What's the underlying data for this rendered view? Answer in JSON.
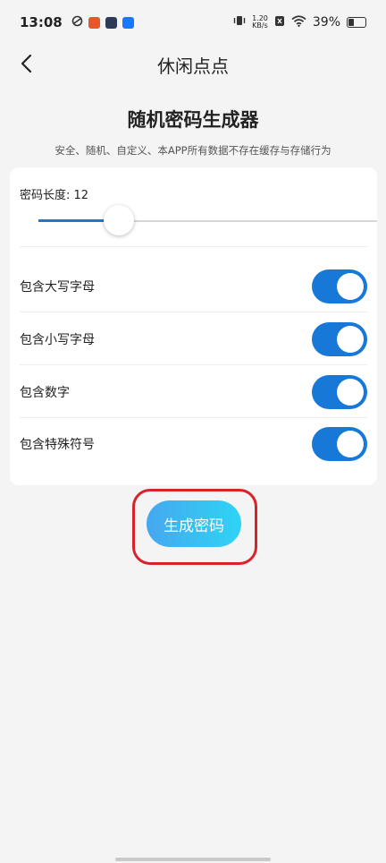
{
  "status_bar": {
    "time": "13:08",
    "net_speed_value": "1.20",
    "net_speed_unit": "KB/s",
    "battery": "39%"
  },
  "header": {
    "title": "休闲点点"
  },
  "page": {
    "title": "随机密码生成器",
    "subtitle": "安全、随机、自定义、本APP所有数据不存在缓存与存储行为"
  },
  "length": {
    "label": "密码长度: 12",
    "value": 12
  },
  "options": [
    {
      "label": "包含大写字母",
      "enabled": true
    },
    {
      "label": "包含小写字母",
      "enabled": true
    },
    {
      "label": "包含数字",
      "enabled": true
    },
    {
      "label": "包含特殊符号",
      "enabled": true
    }
  ],
  "generate_button": {
    "label": "生成密码"
  },
  "colors": {
    "accent": "#1778d8",
    "button_gradient_start": "#45a8ef",
    "button_gradient_end": "#2ed4f4",
    "highlight_box": "#d8232a"
  }
}
